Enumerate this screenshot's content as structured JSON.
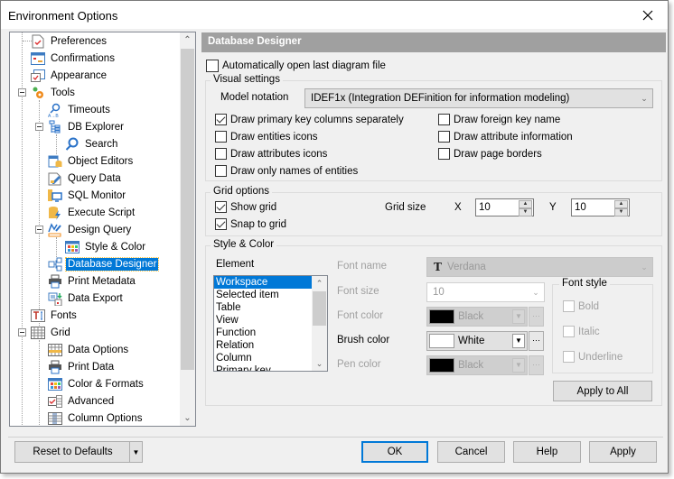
{
  "window": {
    "title": "Environment Options",
    "close_icon": "close-icon"
  },
  "tree": {
    "items": [
      {
        "label": "Preferences",
        "icon": "preferences-icon",
        "level": 1
      },
      {
        "label": "Confirmations",
        "icon": "confirmations-icon",
        "level": 1
      },
      {
        "label": "Appearance",
        "icon": "appearance-icon",
        "level": 1
      },
      {
        "label": "Tools",
        "icon": "tools-icon",
        "level": 1,
        "expanded": true
      },
      {
        "label": "Timeouts",
        "icon": "timeouts-icon",
        "level": 2
      },
      {
        "label": "DB Explorer",
        "icon": "db-explorer-icon",
        "level": 2,
        "expanded": true
      },
      {
        "label": "Search",
        "icon": "search-icon",
        "level": 3
      },
      {
        "label": "Object Editors",
        "icon": "object-editors-icon",
        "level": 2
      },
      {
        "label": "Query Data",
        "icon": "query-data-icon",
        "level": 2
      },
      {
        "label": "SQL Monitor",
        "icon": "sql-monitor-icon",
        "level": 2
      },
      {
        "label": "Execute Script",
        "icon": "execute-script-icon",
        "level": 2
      },
      {
        "label": "Design Query",
        "icon": "design-query-icon",
        "level": 2,
        "expanded": true
      },
      {
        "label": "Style & Color",
        "icon": "style-color-icon",
        "level": 3
      },
      {
        "label": "Database Designer",
        "icon": "database-designer-icon",
        "level": 2,
        "selected": true
      },
      {
        "label": "Print Metadata",
        "icon": "print-metadata-icon",
        "level": 2
      },
      {
        "label": "Data Export",
        "icon": "data-export-icon",
        "level": 2
      },
      {
        "label": "Fonts",
        "icon": "fonts-icon",
        "level": 1
      },
      {
        "label": "Grid",
        "icon": "grid-icon",
        "level": 1,
        "expanded": true
      },
      {
        "label": "Data Options",
        "icon": "data-options-icon",
        "level": 2
      },
      {
        "label": "Print Data",
        "icon": "print-data-icon",
        "level": 2
      },
      {
        "label": "Color & Formats",
        "icon": "color-formats-icon",
        "level": 2
      },
      {
        "label": "Advanced",
        "icon": "advanced-icon",
        "level": 2
      },
      {
        "label": "Column Options",
        "icon": "column-options-icon",
        "level": 2
      }
    ]
  },
  "panel": {
    "header": "Database Designer",
    "auto_open": {
      "label": "Automatically open last diagram file",
      "checked": false
    },
    "visual_settings": {
      "title": "Visual settings",
      "model_notation_label": "Model notation",
      "model_notation_value": "IDEF1x (Integration DEFinition for information modeling)",
      "options": [
        {
          "label": "Draw primary key columns separately",
          "checked": true
        },
        {
          "label": "Draw entities icons",
          "checked": false
        },
        {
          "label": "Draw attributes icons",
          "checked": false
        },
        {
          "label": "Draw only names of entities",
          "checked": false
        },
        {
          "label": "Draw foreign key name",
          "checked": false
        },
        {
          "label": "Draw attribute information",
          "checked": false
        },
        {
          "label": "Draw page borders",
          "checked": false
        }
      ]
    },
    "grid_options": {
      "title": "Grid options",
      "show_grid": {
        "label": "Show grid",
        "checked": true
      },
      "snap_to_grid": {
        "label": "Snap to grid",
        "checked": true
      },
      "grid_size_label": "Grid size",
      "x_label": "X",
      "x_value": "10",
      "y_label": "Y",
      "y_value": "10"
    },
    "style_color": {
      "title": "Style & Color",
      "element_label": "Element",
      "elements": [
        "Workspace",
        "Selected item",
        "Table",
        "View",
        "Function",
        "Relation",
        "Column",
        "Primary key"
      ],
      "selected_element": "Workspace",
      "font_name_label": "Font name",
      "font_name_value": "Verdana",
      "font_size_label": "Font size",
      "font_size_value": "10",
      "font_color_label": "Font color",
      "font_color_value": "Black",
      "font_color_hex": "#000000",
      "brush_color_label": "Brush color",
      "brush_color_value": "White",
      "brush_color_hex": "#ffffff",
      "pen_color_label": "Pen color",
      "pen_color_value": "Black",
      "pen_color_hex": "#000000",
      "font_style": {
        "title": "Font style",
        "bold": {
          "label": "Bold",
          "checked": false
        },
        "italic": {
          "label": "Italic",
          "checked": false
        },
        "underline": {
          "label": "Underline",
          "checked": false
        }
      },
      "apply_to_all": "Apply to All"
    }
  },
  "footer": {
    "reset": "Reset to Defaults",
    "ok": "OK",
    "cancel": "Cancel",
    "help": "Help",
    "apply": "Apply"
  },
  "colors": {
    "accent": "#0078d7",
    "header_bg": "#a0a0a0",
    "dialog_bg": "#f0f0f0"
  }
}
